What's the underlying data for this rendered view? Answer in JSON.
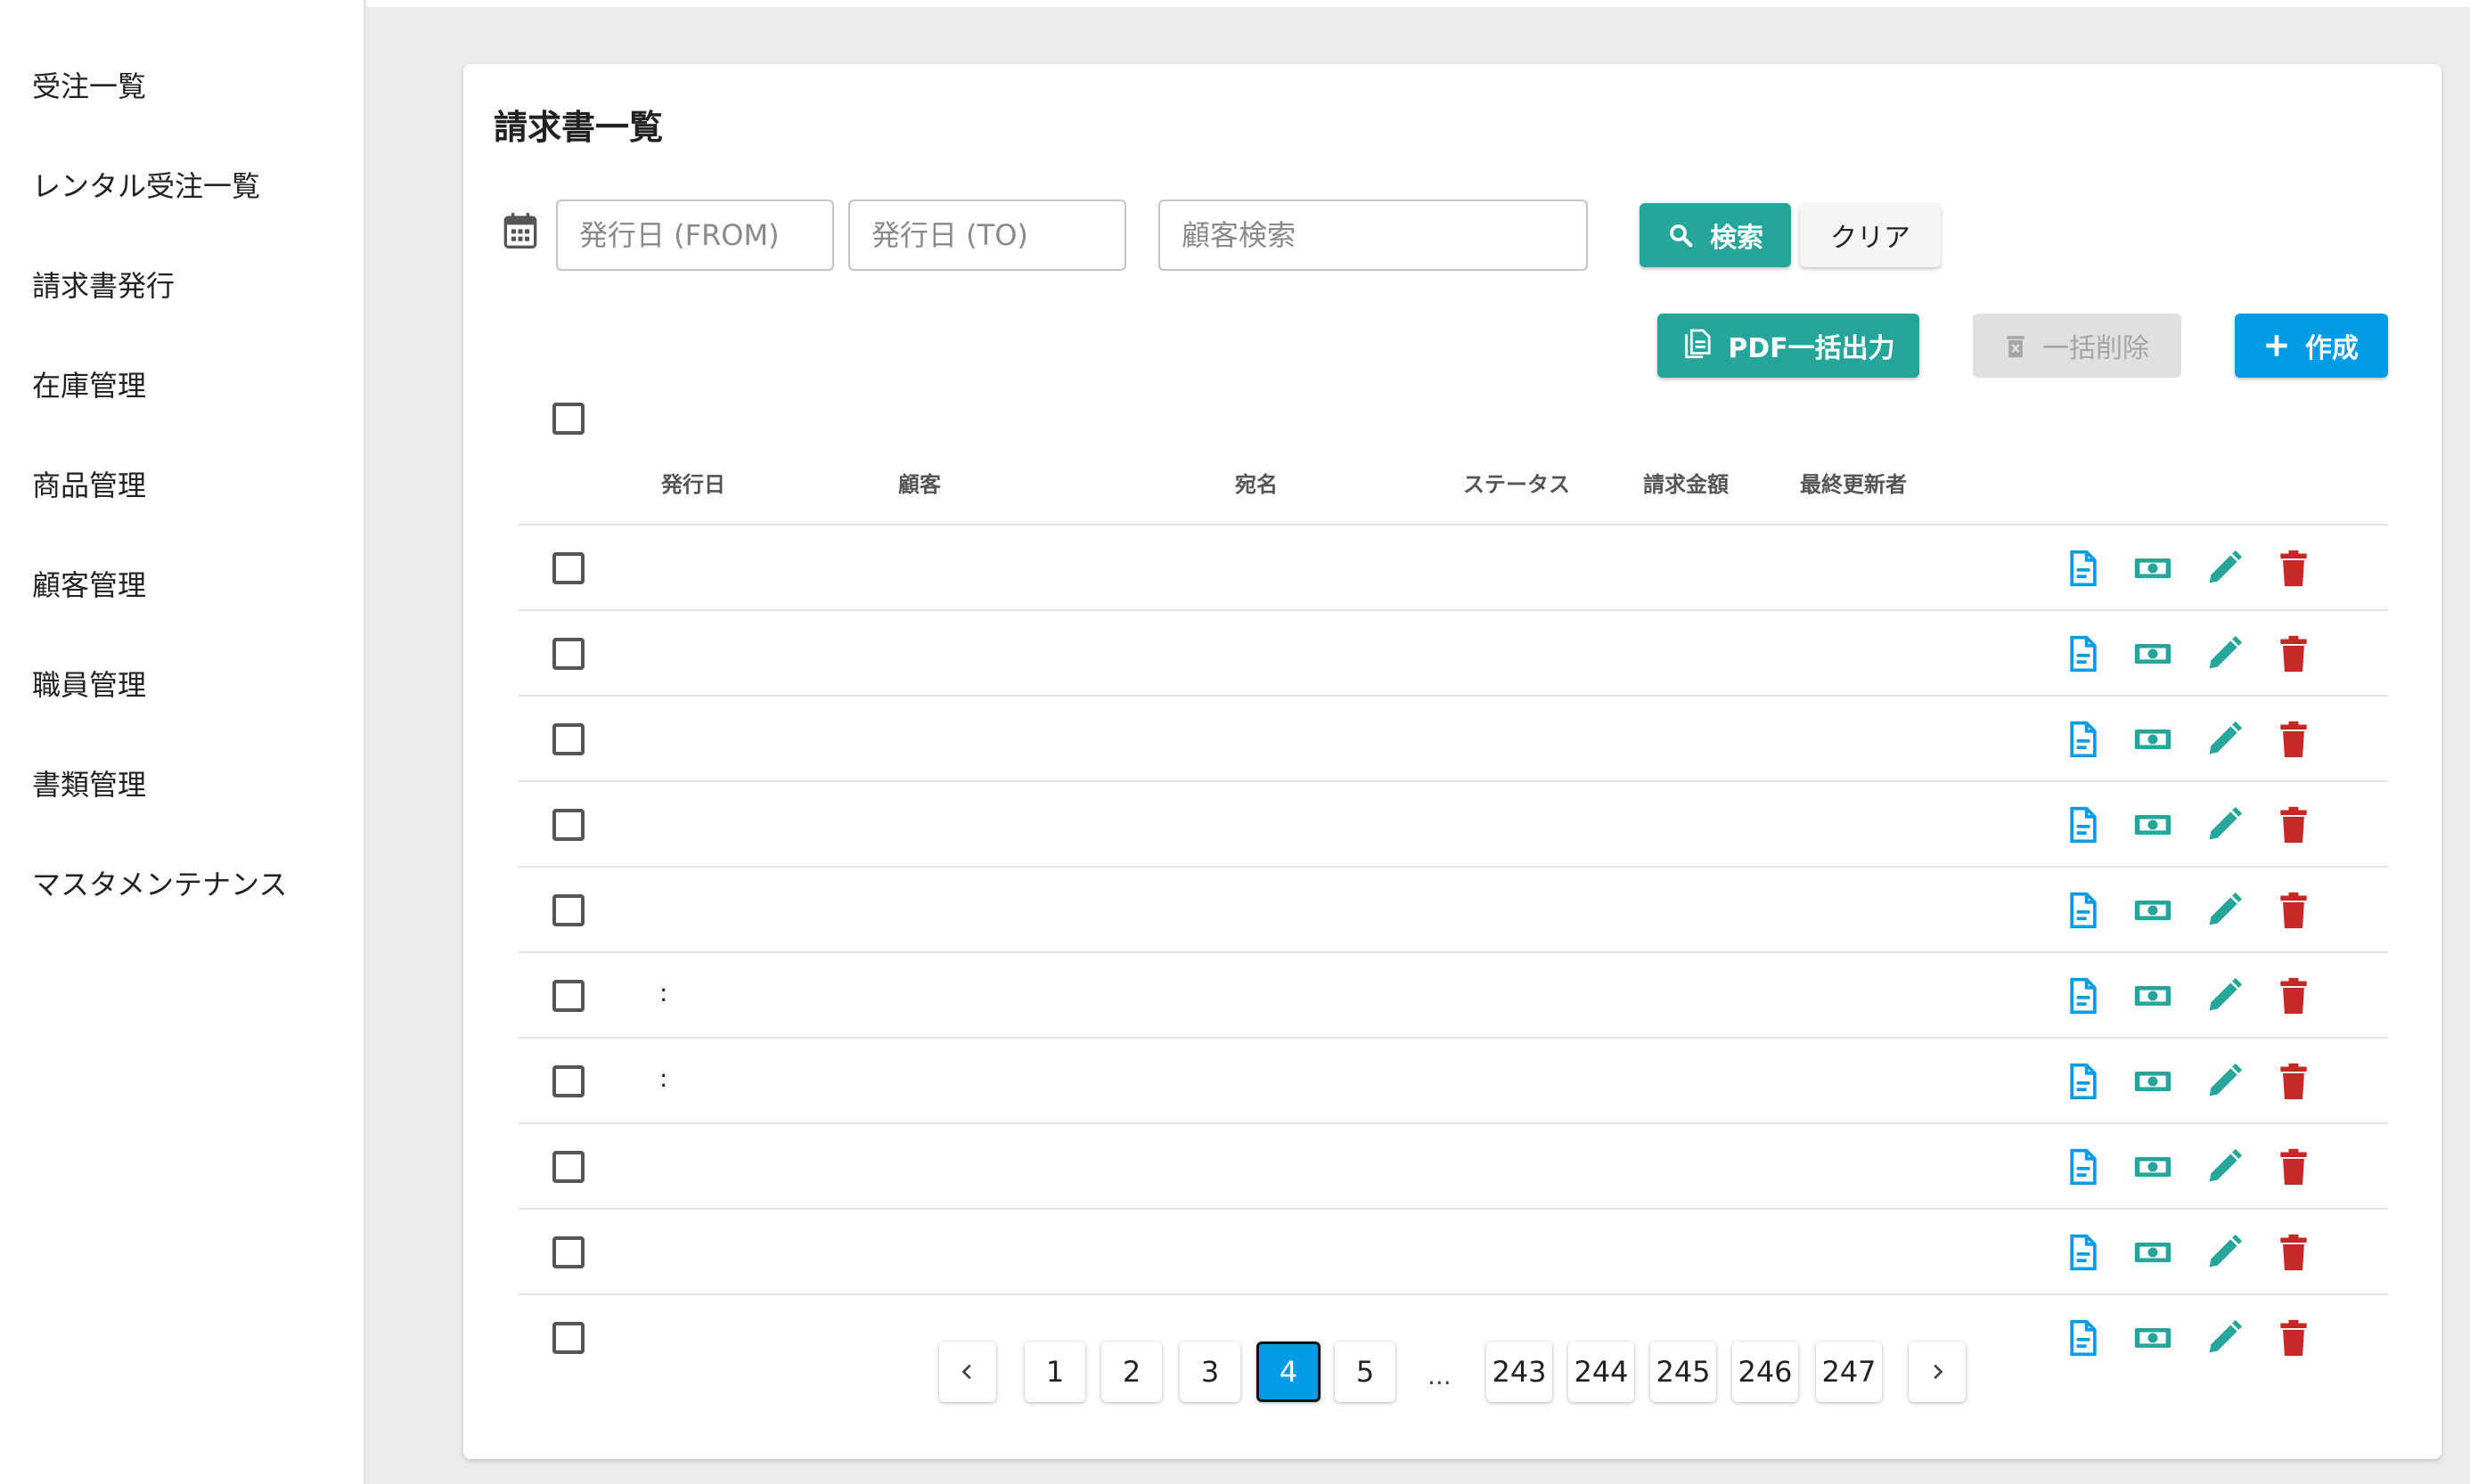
{
  "sidebar": {
    "items": [
      {
        "label": "受注一覧"
      },
      {
        "label": "レンタル受注一覧"
      },
      {
        "label": "請求書発行"
      },
      {
        "label": "在庫管理"
      },
      {
        "label": "商品管理"
      },
      {
        "label": "顧客管理"
      },
      {
        "label": "職員管理"
      },
      {
        "label": "書類管理"
      },
      {
        "label": "マスタメンテナンス"
      }
    ]
  },
  "page": {
    "title": "請求書一覧"
  },
  "filters": {
    "date_from_placeholder": "発行日 (FROM)",
    "date_to_placeholder": "発行日 (TO)",
    "customer_placeholder": "顧客検索",
    "search_label": "検索",
    "clear_label": "クリア"
  },
  "toolbar": {
    "pdf_label": "PDF一括出力",
    "bulk_delete_label": "一括削除",
    "create_label": "作成"
  },
  "table": {
    "headers": {
      "issue_date": "発行日",
      "customer": "顧客",
      "address_name": "宛名",
      "status": "ステータス",
      "amount": "請求金額",
      "last_updated_by": "最終更新者"
    },
    "rows": [
      {
        "issue_date": ""
      },
      {
        "issue_date": ""
      },
      {
        "issue_date": ""
      },
      {
        "issue_date": ""
      },
      {
        "issue_date": ""
      },
      {
        "issue_date": ":"
      },
      {
        "issue_date": ":"
      },
      {
        "issue_date": ""
      },
      {
        "issue_date": ""
      },
      {
        "issue_date": ""
      }
    ]
  },
  "pagination": {
    "pages": [
      "1",
      "2",
      "3",
      "4",
      "5",
      "243",
      "244",
      "245",
      "246",
      "247"
    ],
    "current": "4",
    "ellipsis": "..."
  },
  "colors": {
    "teal": "#26a69a",
    "blue": "#039be5",
    "red": "#c62828",
    "disabled": "#e0e0e0"
  }
}
